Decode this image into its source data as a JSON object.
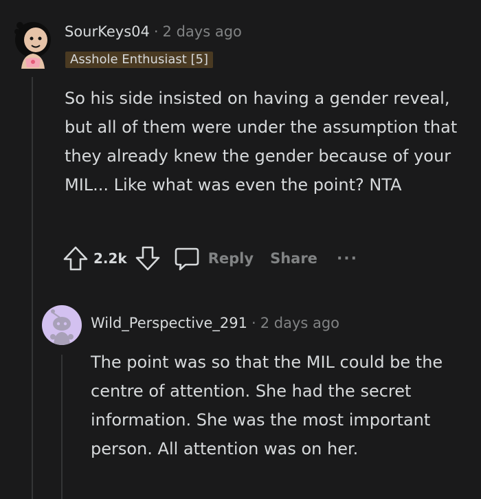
{
  "comment": {
    "username": "SourKeys04",
    "separator": "·",
    "time": "2 days ago",
    "flair": "Asshole Enthusiast [5]",
    "body": "So his side insisted on having a gender reveal, but all of them were under the assumption that they already knew the gender because of your MIL... Like what was even the point? NTA",
    "score": "2.2k",
    "reply_label": "Reply",
    "share_label": "Share",
    "more_label": "···"
  },
  "reply": {
    "username": "Wild_Perspective_291",
    "separator": "·",
    "time": "2 days ago",
    "body": "The point was so that the MIL could be the centre of attention. She had the secret information. She was the most important person. All attention was on her."
  },
  "colors": {
    "background": "#1a1a1b",
    "text": "#d7dadc",
    "muted": "#818384",
    "flair_bg": "#4a3a22",
    "avatar2_bg": "#d3c1f0"
  }
}
